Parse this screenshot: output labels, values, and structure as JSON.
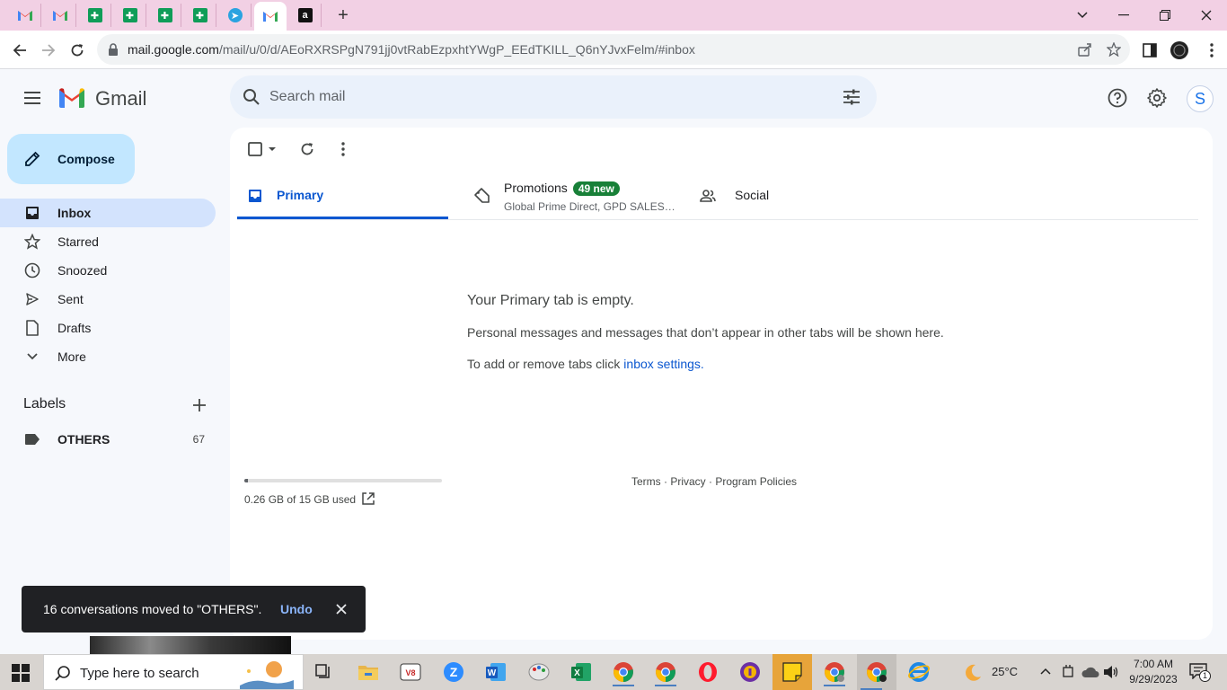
{
  "browser": {
    "url_host": "mail.google.com",
    "url_path": "/mail/u/0/d/AEoRXRSPgN791jj0vtRabEzpxhtYWgP_EEdTKILL_Q6nYJvxFelm/#inbox",
    "new_tab": "+"
  },
  "gmail": {
    "brand": "Gmail",
    "search_placeholder": "Search mail",
    "avatar_letter": "S",
    "compose_label": "Compose",
    "nav": [
      {
        "label": "Inbox",
        "icon": "inbox-icon"
      },
      {
        "label": "Starred",
        "icon": "star-icon"
      },
      {
        "label": "Snoozed",
        "icon": "clock-icon"
      },
      {
        "label": "Sent",
        "icon": "send-icon"
      },
      {
        "label": "Drafts",
        "icon": "draft-icon"
      },
      {
        "label": "More",
        "icon": "chevron-down-icon"
      }
    ],
    "labels_heading": "Labels",
    "labels": [
      {
        "name": "OTHERS",
        "count": "67"
      }
    ],
    "tabs": {
      "primary": "Primary",
      "promotions": "Promotions",
      "promotions_badge": "49 new",
      "promotions_sub": "Global Prime Direct, GPD SALES…",
      "social": "Social"
    },
    "empty": {
      "title": "Your Primary tab is empty.",
      "line1": "Personal messages and messages that don’t appear in other tabs will be shown here.",
      "line2_prefix": "To add or remove tabs click ",
      "line2_link": "inbox settings",
      "line2_suffix": "."
    },
    "storage": {
      "text": "0.26 GB of 15 GB used",
      "used_gb": 0.26,
      "total_gb": 15
    },
    "footer": {
      "terms": "Terms",
      "privacy": "Privacy",
      "policies": "Program Policies",
      "sep": " · "
    },
    "snackbar": {
      "message": "16 conversations moved to \"OTHERS\".",
      "undo": "Undo"
    }
  },
  "taskbar": {
    "search_placeholder": "Type here to search",
    "temperature": "25°C",
    "time": "7:00 AM",
    "date": "9/29/2023",
    "notification_count": "1"
  },
  "colors": {
    "tabstrip": "#f2d0e4",
    "accent": "#0b57d0",
    "compose": "#c2e7ff",
    "nav_active": "#d3e3fd",
    "badge": "#188038"
  }
}
